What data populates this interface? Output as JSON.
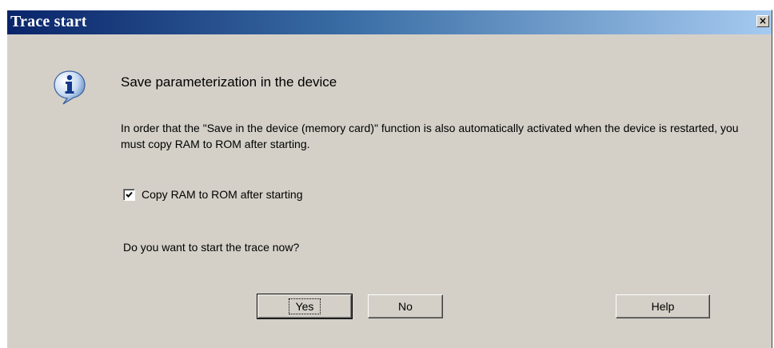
{
  "dialog": {
    "title": "Trace start",
    "close_glyph": "×",
    "icon": "info-icon",
    "heading": "Save parameterization in the device",
    "message": "In order that the \"Save in the device (memory card)\" function is also automatically activated when the device is restarted, you must copy RAM to ROM after starting.",
    "checkbox": {
      "label": "Copy RAM to ROM after starting",
      "checked": true
    },
    "question": "Do you want to start the trace now?",
    "buttons": {
      "yes": "Yes",
      "no": "No",
      "help": "Help"
    }
  },
  "colors": {
    "titlebar_start": "#0a246a",
    "titlebar_end": "#a6caf0",
    "face": "#d4d0c8"
  }
}
